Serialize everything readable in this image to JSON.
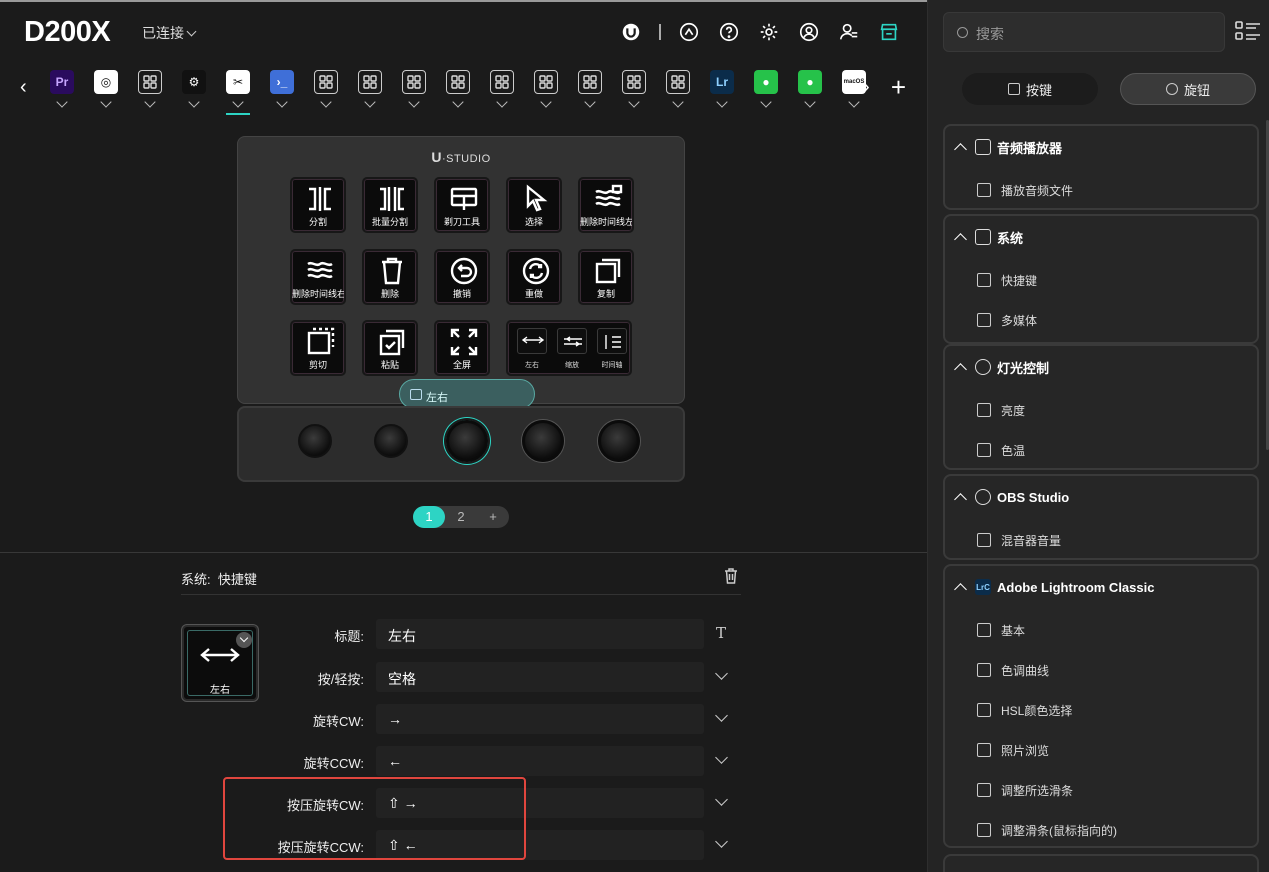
{
  "header": {
    "device_name": "D200X",
    "connection_status": "已连接"
  },
  "app_tabs": [
    {
      "id": "premiere",
      "label": "Pr",
      "bg": "#2a0b5e",
      "fg": "#c7a6ff"
    },
    {
      "id": "davinci",
      "label": "◎",
      "bg": "#ffffff",
      "fg": "#111111"
    },
    {
      "id": "grid1",
      "label": "",
      "bg": "",
      "fg": ""
    },
    {
      "id": "gear",
      "label": "⚙",
      "bg": "#111111",
      "fg": "#ffffff"
    },
    {
      "id": "capcut",
      "label": "✂",
      "bg": "#ffffff",
      "fg": "#111111",
      "active": true
    },
    {
      "id": "terminal",
      "label": "›_",
      "bg": "#3f6fd8",
      "fg": "#ffffff"
    },
    {
      "id": "grid2",
      "label": ""
    },
    {
      "id": "grid3",
      "label": ""
    },
    {
      "id": "grid4",
      "label": ""
    },
    {
      "id": "grid5",
      "label": ""
    },
    {
      "id": "grid6",
      "label": ""
    },
    {
      "id": "grid7",
      "label": ""
    },
    {
      "id": "grid8",
      "label": ""
    },
    {
      "id": "grid9",
      "label": ""
    },
    {
      "id": "grid10",
      "label": ""
    },
    {
      "id": "lightroom",
      "label": "Lr",
      "bg": "#0b2c4a",
      "fg": "#8fd1ff"
    },
    {
      "id": "wechat1",
      "label": "●",
      "bg": "#26c24a",
      "fg": "#ffffff"
    },
    {
      "id": "wechat2",
      "label": "●",
      "bg": "#26c24a",
      "fg": "#ffffff"
    },
    {
      "id": "macos",
      "label": "macOS",
      "bg": "#ffffff",
      "fg": "#111111"
    }
  ],
  "device": {
    "brand_u": "U",
    "brand_rest": "·STUDIO",
    "keys": [
      {
        "label": "分割",
        "icon": "split"
      },
      {
        "label": "批量分割",
        "icon": "batch"
      },
      {
        "label": "剃刀工具",
        "icon": "razor"
      },
      {
        "label": "选择",
        "icon": "cursor"
      },
      {
        "label": "删除时间线左",
        "icon": "waves"
      },
      {
        "label": "删除时间线右",
        "icon": "waves2"
      },
      {
        "label": "删除",
        "icon": "trash"
      },
      {
        "label": "撤销",
        "icon": "undo"
      },
      {
        "label": "重做",
        "icon": "redo"
      },
      {
        "label": "复制",
        "icon": "copy"
      },
      {
        "label": "剪切",
        "icon": "cut"
      },
      {
        "label": "粘贴",
        "icon": "paste"
      },
      {
        "label": "全屏",
        "icon": "fullscreen"
      }
    ],
    "wide_key": [
      "左右",
      "缩放",
      "时间轴"
    ],
    "tooltip": "左右",
    "pages": [
      "1",
      "2",
      "+"
    ]
  },
  "editor": {
    "section_category": "系统:",
    "section_title": "快捷键",
    "preview_label": "左右",
    "fields": [
      {
        "label": "标题:",
        "value": "左右",
        "button": "text"
      },
      {
        "label": "按/轻按:",
        "value": "空格",
        "button": "dropdown"
      },
      {
        "label": "旋转CW:",
        "value": "→",
        "button": "dropdown"
      },
      {
        "label": "旋转CCW:",
        "value": "←",
        "button": "dropdown"
      },
      {
        "label": "按压旋转CW:",
        "value": "⇧ →",
        "button": "dropdown"
      },
      {
        "label": "按压旋转CCW:",
        "value": "⇧ ←",
        "button": "dropdown"
      }
    ]
  },
  "sidebar": {
    "search_placeholder": "搜索",
    "tab_keys": "按键",
    "tab_knobs": "旋钮",
    "groups": [
      {
        "title": "音频播放器",
        "items": [
          "播放音频文件"
        ]
      },
      {
        "title": "系统",
        "items": [
          "快捷键",
          "多媒体"
        ]
      },
      {
        "title": "灯光控制",
        "items": [
          "亮度",
          "色温"
        ]
      },
      {
        "title": "OBS Studio",
        "items": [
          "混音器音量"
        ]
      },
      {
        "title": "Adobe Lightroom Classic",
        "items": [
          "基本",
          "色调曲线",
          "HSL颜色选择",
          "照片浏览",
          "调整所选滑条",
          "调整滑条(鼠标指向的)"
        ]
      }
    ]
  },
  "colors": {
    "accent": "#2dd4c4",
    "highlight": "#e0463e"
  }
}
